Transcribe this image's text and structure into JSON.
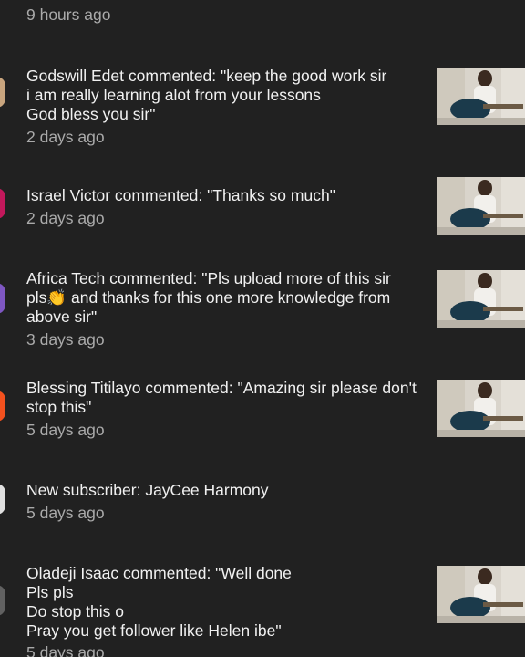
{
  "notifications": [
    {
      "text": "",
      "time": "9 hours ago",
      "avatar_color": "#5a4a3a"
    },
    {
      "text": "Godswill Edet commented: \"keep the good work sir\ni am really learning alot from your lessons\nGod bless you sir\"",
      "time": "2 days ago",
      "avatar_color": "#c9a57e"
    },
    {
      "text": "Israel Victor commented: \"Thanks so much\"",
      "time": "2 days ago",
      "avatar_color": "#c2185b"
    },
    {
      "text": "Africa Tech commented: \"Pls upload more of this sir\npls👏 and thanks for this one more knowledge from\nabove sir\"",
      "time": "3 days ago",
      "avatar_color": "#7e57c2"
    },
    {
      "text": "Blessing Titilayo commented: \"Amazing sir please don't\nstop this\"",
      "time": "5 days ago",
      "avatar_color": "#f4511e"
    },
    {
      "text": "New subscriber: JayCee Harmony",
      "time": "5 days ago",
      "avatar_color": "#e0e0e0"
    },
    {
      "text": "Oladeji Isaac commented: \"Well done\nPls pls\nDo stop this o\nPray you get follower like Helen ibe\"",
      "time": "5 days ago",
      "avatar_color": "#616161"
    }
  ]
}
